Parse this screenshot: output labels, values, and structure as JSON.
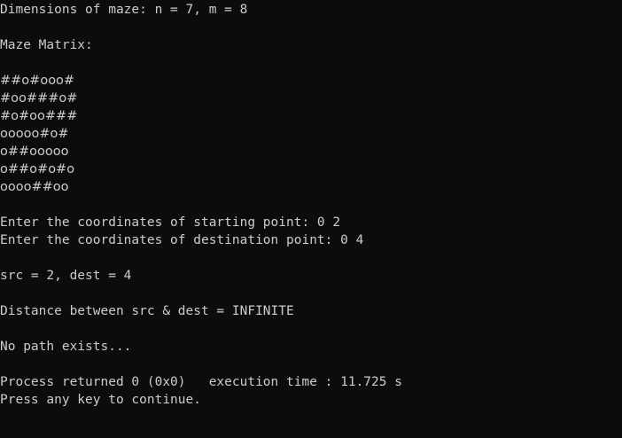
{
  "console": {
    "dimensions_line": "Dimensions of maze: n = 7, m = 8",
    "maze_header": "Maze Matrix:",
    "maze_rows": [
      "##o#ooo#",
      "#oo###o#",
      "#o#oo###",
      "ooooo#o#",
      "o##ooooo",
      "o##o#o#o",
      "oooo##oo"
    ],
    "prompt_start": "Enter the coordinates of starting point: 0 2",
    "prompt_dest": "Enter the coordinates of destination point: 0 4",
    "src_dest_line": "src = 2, dest = 4",
    "distance_line": "Distance between src & dest = INFINITE",
    "no_path_line": "No path exists...",
    "process_line": "Process returned 0 (0x0)   execution time : 11.725 s",
    "press_key_line": "Press any key to continue."
  },
  "colors": {
    "background": "#0c0c0c",
    "text": "#cccccc"
  }
}
